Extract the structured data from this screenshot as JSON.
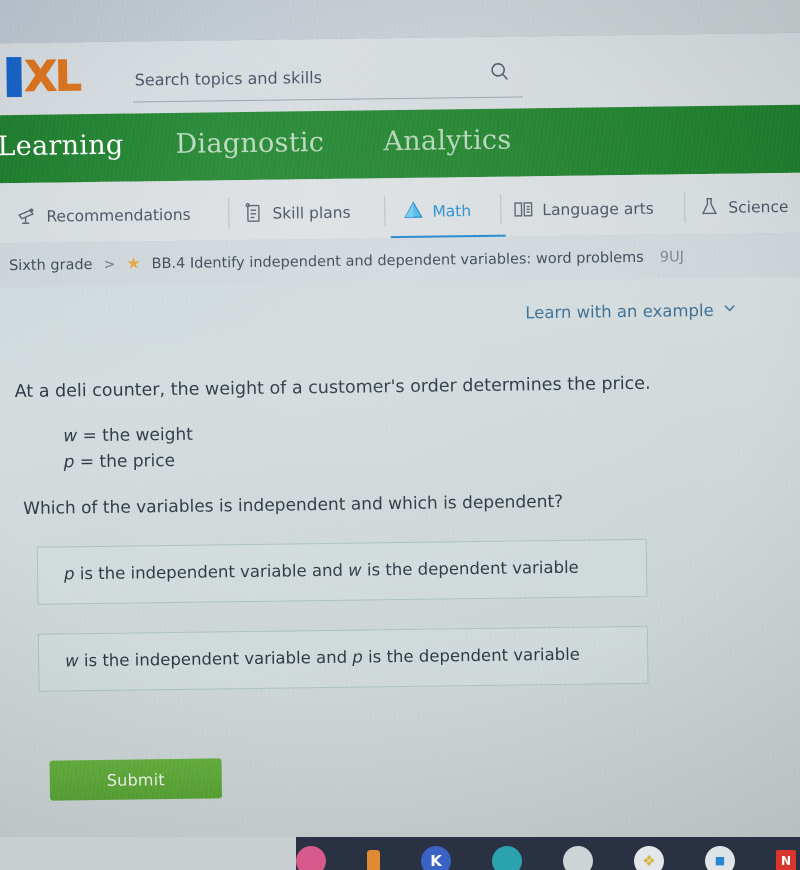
{
  "search": {
    "placeholder": "Search topics and skills",
    "value": "",
    "icon": "search-icon"
  },
  "brand": {
    "letter_i": "I",
    "letter_xl": "XL",
    "color_blue": "#1760c4",
    "color_orange": "#d9711f"
  },
  "top_nav": {
    "items": [
      {
        "label": "Learning",
        "active": true
      },
      {
        "label": "Diagnostic",
        "active": false
      },
      {
        "label": "Analytics",
        "active": false
      }
    ],
    "bar_color": "#27843 3"
  },
  "tabs": [
    {
      "label": "Recommendations",
      "icon": "telescope-icon",
      "active": false
    },
    {
      "label": "Skill plans",
      "icon": "checklist-icon",
      "active": false
    },
    {
      "label": "Math",
      "icon": "pyramid-icon",
      "active": true
    },
    {
      "label": "Language arts",
      "icon": "book-icon",
      "active": false
    },
    {
      "label": "Science",
      "icon": "flask-icon",
      "active": false
    }
  ],
  "breadcrumb": {
    "grade": "Sixth grade",
    "separator": ">",
    "star": "★",
    "skill": "BB.4 Identify independent and dependent variables: word problems",
    "code": "9UJ"
  },
  "example": {
    "label": "Learn with an example",
    "chevron": "⌄"
  },
  "question": {
    "stem": "At a deli counter, the weight of a customer's order determines the price.",
    "variables": [
      {
        "symbol": "w",
        "definition": "= the weight"
      },
      {
        "symbol": "p",
        "definition": "= the price"
      }
    ],
    "prompt": "Which of the variables is independent and which is dependent?",
    "choices": [
      {
        "id": "choice-a",
        "part1_symbol": "p",
        "part1_text": " is the independent variable and ",
        "part2_symbol": "w",
        "part2_text": " is the dependent variable",
        "selected": false
      },
      {
        "id": "choice-b",
        "part1_symbol": "w",
        "part1_text": " is the independent variable and ",
        "part2_symbol": "p",
        "part2_text": " is the dependent variable",
        "selected": false
      }
    ]
  },
  "submit": {
    "label": "Submit",
    "color": "#5aa335"
  },
  "taskbar": {
    "icons": [
      {
        "name": "pink-app-icon",
        "color": "#d65a8a",
        "glyph": ""
      },
      {
        "name": "orange-app-icon",
        "color": "#e08a33",
        "glyph": ""
      },
      {
        "name": "kahoot-icon",
        "color": "#3b63c4",
        "glyph": "K"
      },
      {
        "name": "teal-app-icon",
        "color": "#2ba3ae",
        "glyph": ""
      },
      {
        "name": "grey-app-icon",
        "color": "#cfd4d6",
        "glyph": ""
      },
      {
        "name": "puzzle-icon",
        "color": "#e0e4e6",
        "glyph": "❖"
      },
      {
        "name": "camera-icon",
        "color": "#2a86d0",
        "glyph": "■"
      },
      {
        "name": "nearpod-icon",
        "color": "#d8352c",
        "glyph": "N"
      }
    ]
  }
}
